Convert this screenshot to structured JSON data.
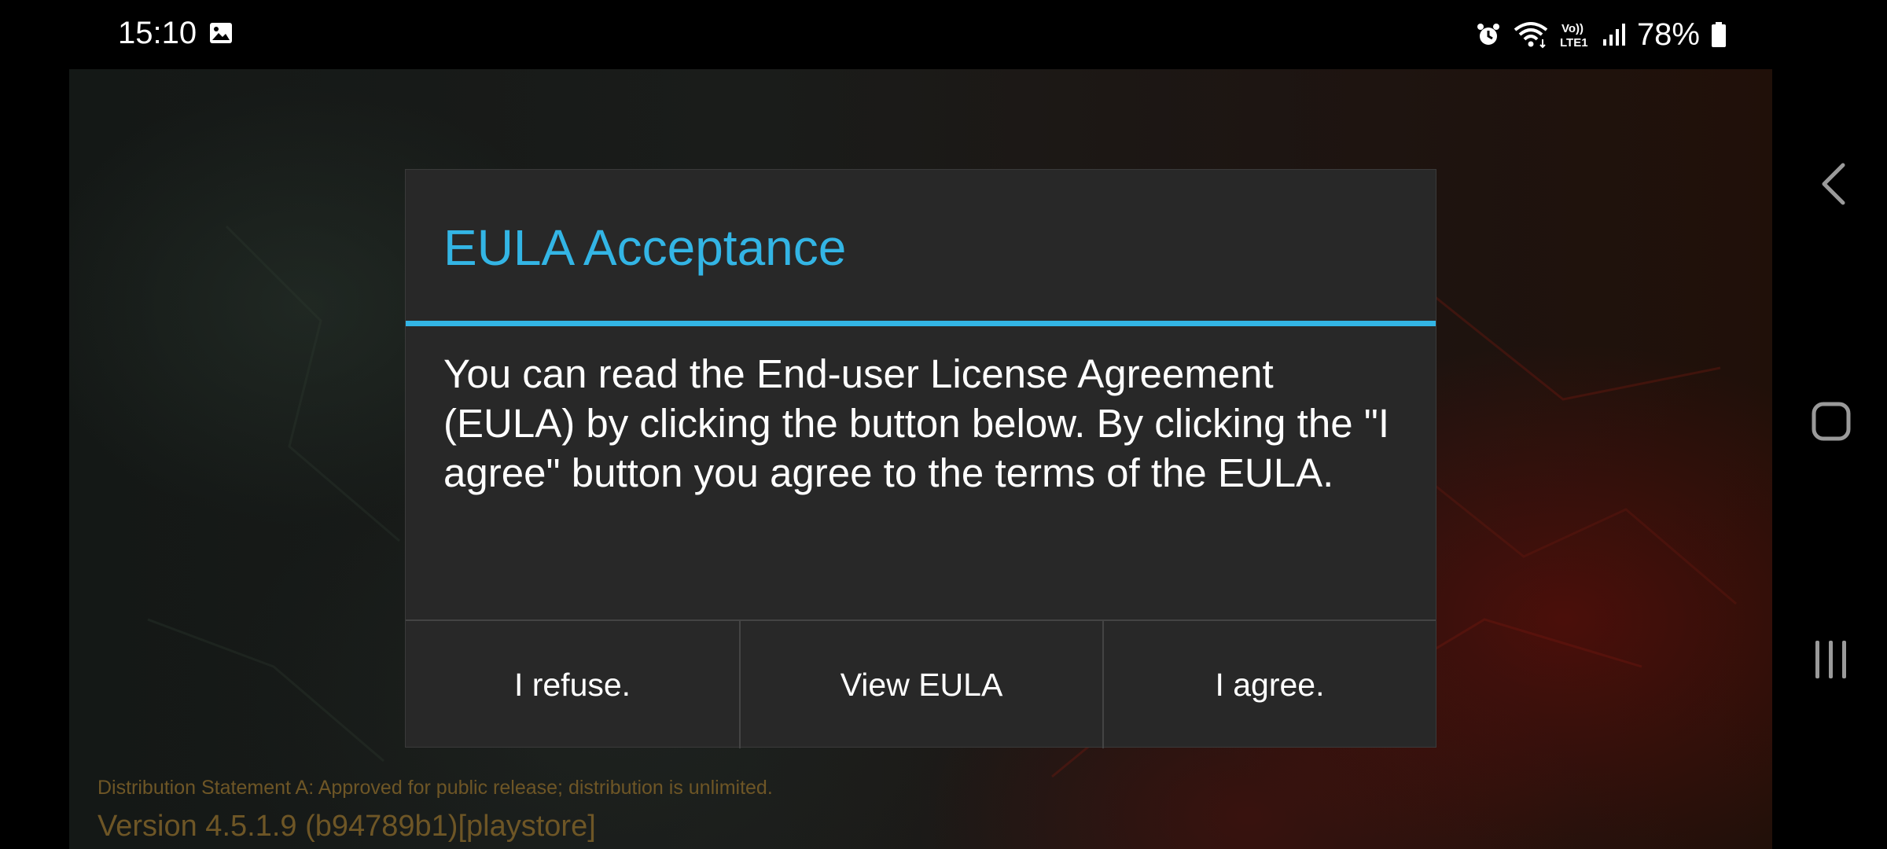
{
  "status_bar": {
    "time": "15:10",
    "battery": "78%",
    "icons": [
      "gallery-icon",
      "alarm-icon",
      "wifi-icon",
      "volte-icon",
      "signal-icon",
      "battery-icon"
    ],
    "volte_line1": "Vo))",
    "volte_line2": "LTE1"
  },
  "dialog": {
    "title": "EULA Acceptance",
    "message": "You can read the End-user License Agreement (EULA) by clicking the button below. By clicking the \"I agree\" button you agree to the terms of the EULA.",
    "buttons": {
      "refuse": "I refuse.",
      "view": "View EULA",
      "agree": "I agree."
    },
    "accent_color": "#33b5e5"
  },
  "footer": {
    "distribution": "Distribution Statement A: Approved for public release; distribution is unlimited.",
    "version": "Version 4.5.1.9 (b94789b1)[playstore]"
  },
  "nav_bar": {
    "icons": [
      "back-icon",
      "home-icon",
      "recent-apps-icon"
    ]
  }
}
